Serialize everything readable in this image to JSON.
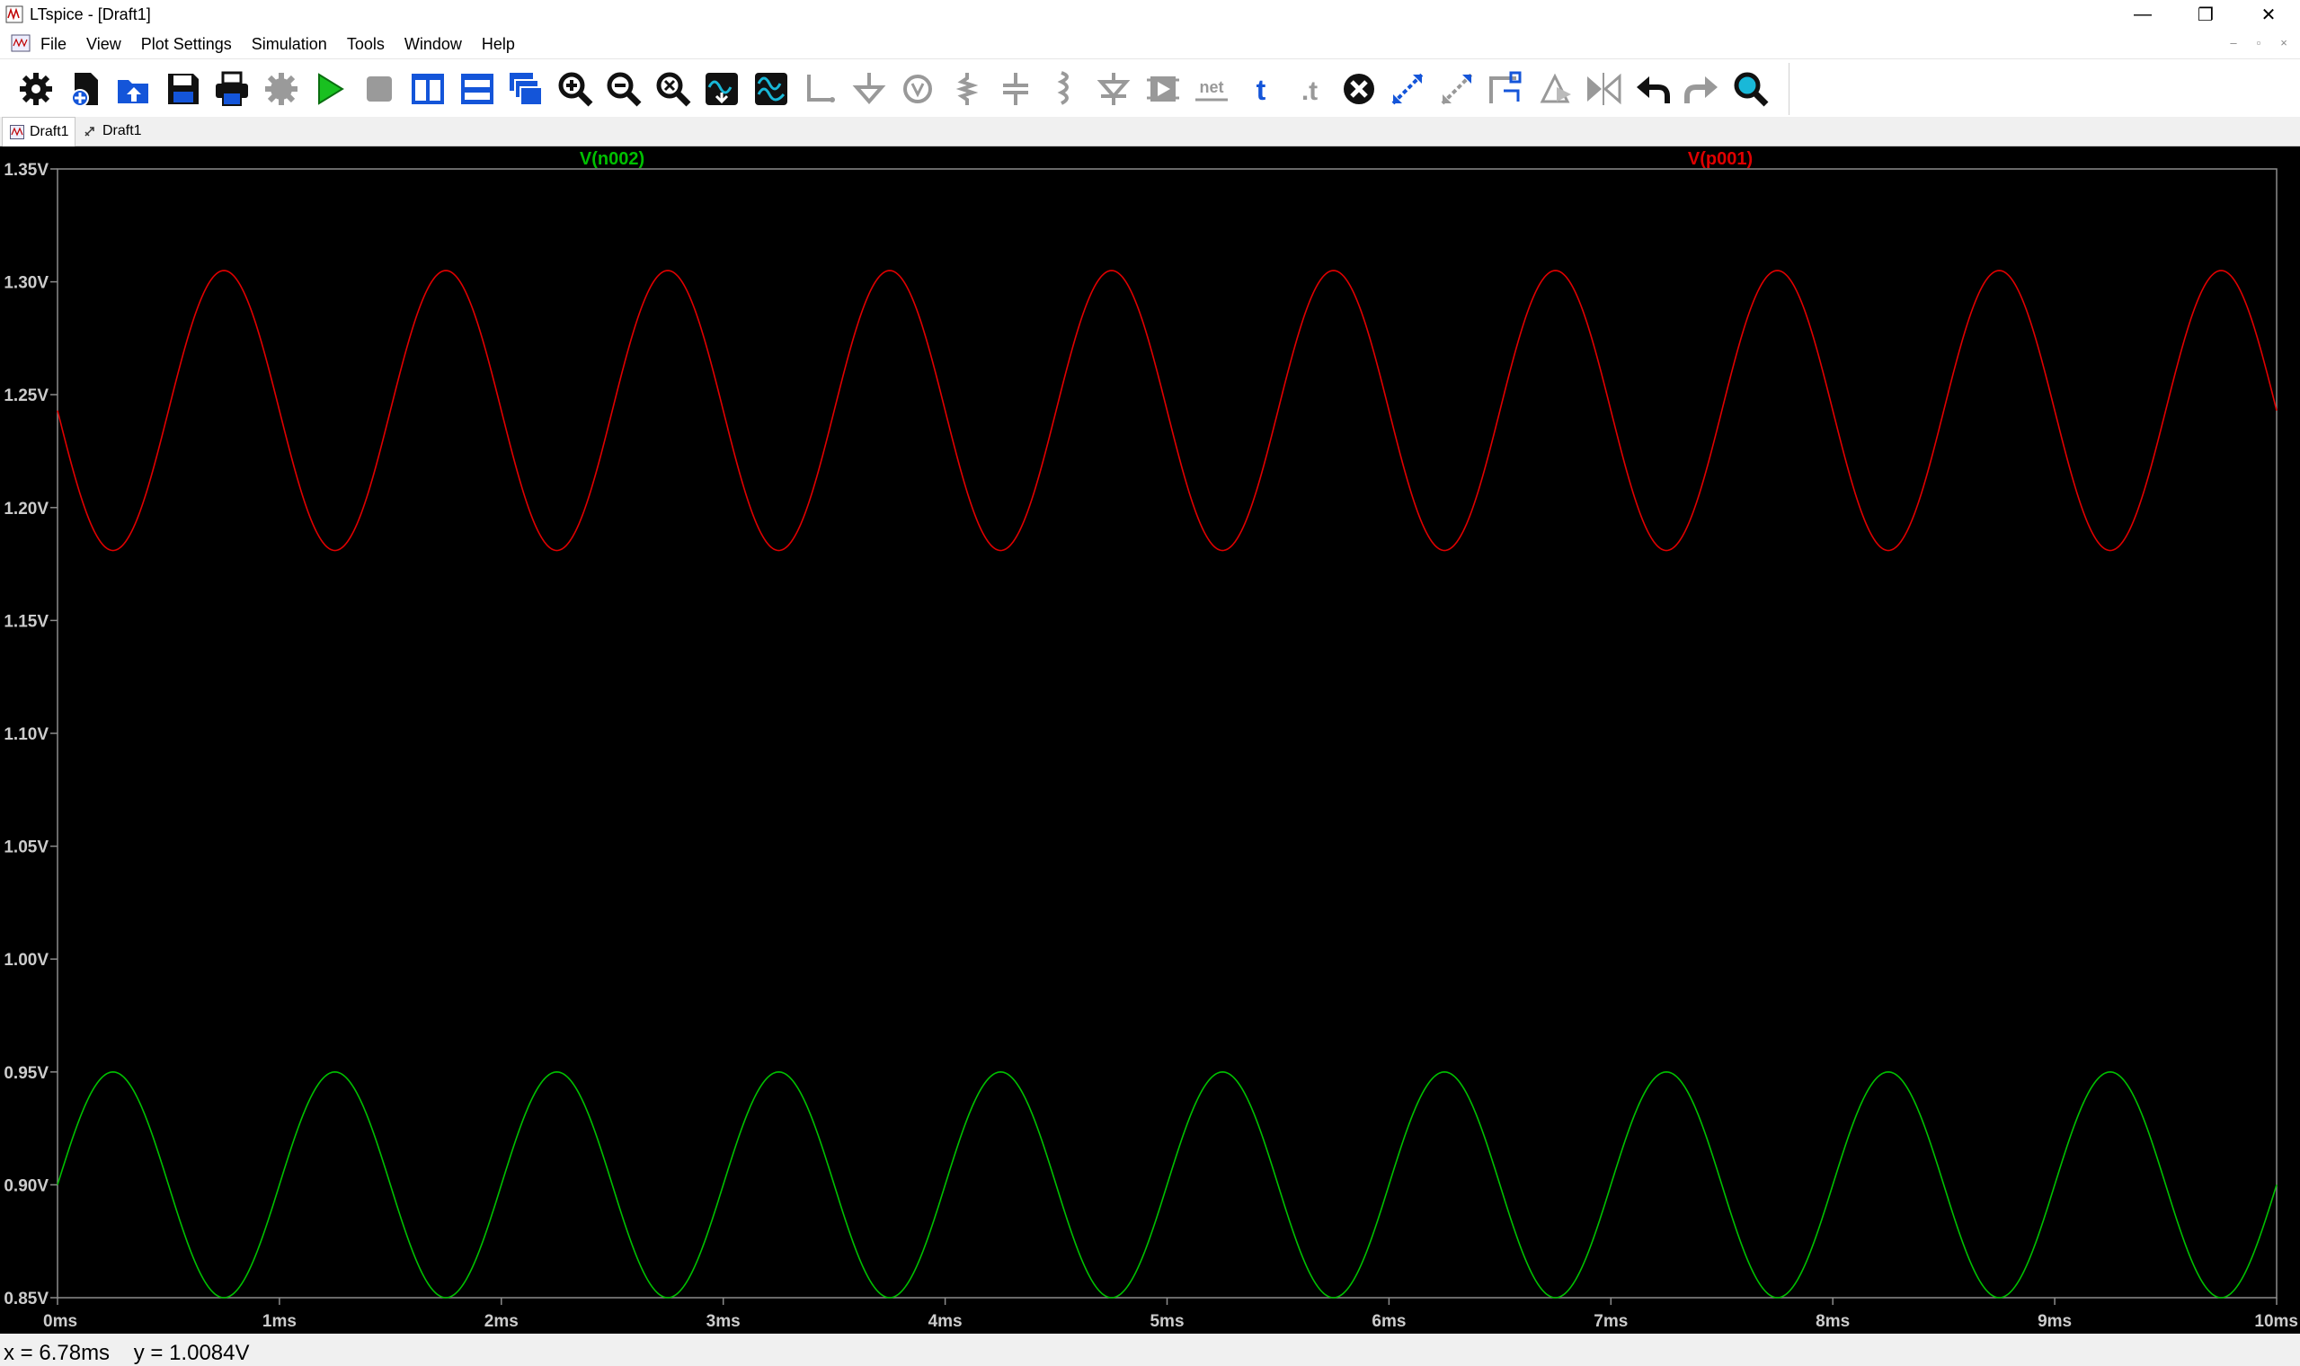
{
  "window": {
    "title": "LTspice - [Draft1]",
    "controls": {
      "minimize": "—",
      "restore": "❐",
      "close": "✕"
    }
  },
  "menu": {
    "items": [
      "File",
      "View",
      "Plot Settings",
      "Simulation",
      "Tools",
      "Window",
      "Help"
    ]
  },
  "toolbar": {
    "buttons": [
      "gear-icon",
      "new-schematic-icon",
      "open-folder-icon",
      "save-icon",
      "print-icon",
      "control-panel-icon",
      "run-icon",
      "halt-icon",
      "tile-vertical-icon",
      "tile-horizontal-icon",
      "cascade-icon",
      "zoom-in-icon",
      "zoom-out-icon",
      "zoom-fit-icon",
      "autorange-icon",
      "add-trace-icon",
      "wire-icon",
      "ground-icon",
      "label-icon",
      "resistor-icon",
      "capacitor-icon",
      "inductor-icon",
      "diode-icon",
      "component-icon",
      "net-label-icon",
      "text-icon",
      "spice-directive-icon",
      "delete-icon",
      "move-icon",
      "drag-icon",
      "rotate-icon",
      "mirror-icon",
      "flip-icon",
      "undo-icon",
      "redo-icon",
      "find-icon"
    ],
    "net_text": "net",
    "text_t": "t",
    "directive_t": ".t"
  },
  "tabs": [
    {
      "label": "Draft1",
      "icon": "waveform-tab-icon",
      "active": true
    },
    {
      "label": "Draft1",
      "icon": "schematic-tab-icon",
      "active": false
    }
  ],
  "status": {
    "x_readout": "x = 6.78ms",
    "y_readout": "y = 1.0084V"
  },
  "colors": {
    "plot_background": "#000000",
    "axis": "#8c8c8c",
    "tick_text": "#cccccc",
    "n002": "#00c000",
    "p001": "#e00000"
  },
  "chart_data": {
    "type": "line",
    "title": "",
    "xlabel": "",
    "ylabel": "",
    "xlim_ms": [
      0,
      10
    ],
    "ylim_V": [
      0.85,
      1.35
    ],
    "x_ticks": [
      "0ms",
      "1ms",
      "2ms",
      "3ms",
      "4ms",
      "5ms",
      "6ms",
      "7ms",
      "8ms",
      "9ms",
      "10ms"
    ],
    "x_tick_values": [
      0,
      1,
      2,
      3,
      4,
      5,
      6,
      7,
      8,
      9,
      10
    ],
    "y_ticks": [
      "1.35V",
      "1.30V",
      "1.25V",
      "1.20V",
      "1.15V",
      "1.10V",
      "1.05V",
      "1.00V",
      "0.95V",
      "0.90V",
      "0.85V"
    ],
    "y_tick_values": [
      1.35,
      1.3,
      1.25,
      1.2,
      1.15,
      1.1,
      1.05,
      1.0,
      0.95,
      0.9,
      0.85
    ],
    "grid": false,
    "series": [
      {
        "name": "V(n002)",
        "color": "#00c000",
        "offset": 0.9,
        "amplitude": 0.05,
        "frequency_kHz": 1,
        "phase_deg": 0
      },
      {
        "name": "V(p001)",
        "color": "#e00000",
        "offset": 1.243,
        "amplitude": 0.062,
        "frequency_kHz": 1,
        "phase_deg": 180
      }
    ]
  }
}
